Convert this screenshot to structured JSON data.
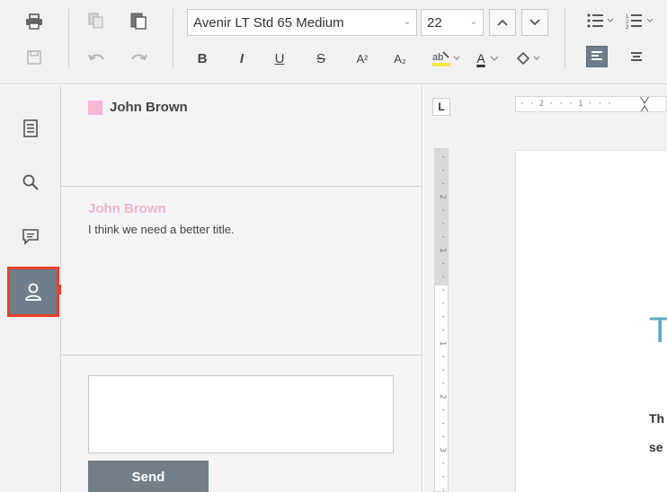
{
  "toolbar": {
    "font_name": "Avenir LT Std 65 Medium",
    "font_size": "22",
    "bold_label": "B",
    "italic_label": "I",
    "underline_label": "U",
    "strike_label": "S",
    "superscript_label": "A²",
    "subscript_label": "A₂",
    "font_color_label": "A",
    "icons": [
      "print-icon",
      "save-icon",
      "copy-icon",
      "paste-icon",
      "undo-icon",
      "redo-icon",
      "increase-size-icon",
      "decrease-size-icon",
      "highlight-icon",
      "fill-icon",
      "bullets-icon",
      "numbering-icon",
      "align-left-icon",
      "align-center-icon"
    ],
    "highlight_color": "#f5e63a",
    "font_color": "#333333"
  },
  "rail": {
    "items": [
      "document-icon",
      "search-icon",
      "comment-icon",
      "user-icon"
    ],
    "active": "user-icon",
    "active_bg": "#6e7e8a",
    "highlight_border": "#e8402a"
  },
  "comments": {
    "author_filter_name": "John Brown",
    "author_color": "#f7b6d2",
    "comment_author": "John Brown",
    "comment_text": "I think we need a better title.",
    "reply_value": "",
    "send_label": "Send"
  },
  "document": {
    "tab_stop_label": "L",
    "h_ruler_text": "· · 2 · · · 1 · · · ",
    "v_ruler_text": "· · · 2 · · · 1 · · · · · · 1 · · · 2 · · · 3 · · ·",
    "title_fragment": "T",
    "line1_fragment": "Th",
    "line2_fragment": "se",
    "title_color": "#5fa8c8"
  }
}
